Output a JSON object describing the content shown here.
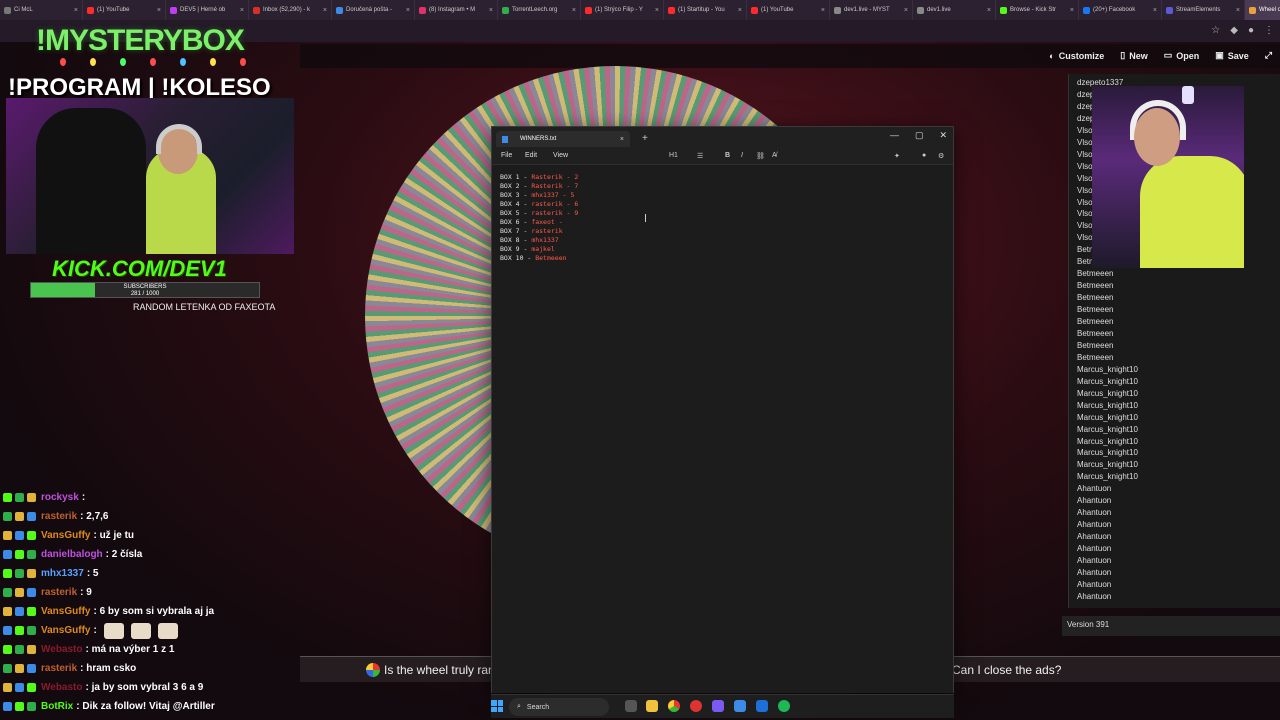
{
  "browser": {
    "tabs": [
      {
        "label": "Ci McL",
        "color": "#777777"
      },
      {
        "label": "(1) YouTube",
        "color": "#ff2a2a"
      },
      {
        "label": "DEV5 | Herné ob",
        "color": "#bf3df0"
      },
      {
        "label": "Inbox (52,290) - k",
        "color": "#d93025"
      },
      {
        "label": "Doručená pošta -",
        "color": "#3c8ce7"
      },
      {
        "label": "(8) Instagram • M",
        "color": "#e1306c"
      },
      {
        "label": "TorrentLeech.org",
        "color": "#2fae4a"
      },
      {
        "label": "(1) Strýco Filip - Y",
        "color": "#ff2a2a"
      },
      {
        "label": "(1) Startitup - You",
        "color": "#ff2a2a"
      },
      {
        "label": "(1) YouTube",
        "color": "#ff2a2a"
      },
      {
        "label": "dev1.live - MYST",
        "color": "#888888"
      },
      {
        "label": "dev1.live",
        "color": "#888888"
      },
      {
        "label": "Browse - Kick Str",
        "color": "#53fc18"
      },
      {
        "label": "(20+) Facebook",
        "color": "#1877f2"
      },
      {
        "label": "StreamElements",
        "color": "#5a5ad6"
      },
      {
        "label": "Wheel of Nam",
        "color": "#e9a23b"
      }
    ]
  },
  "site_actions": {
    "customize": "Customize",
    "new": "New",
    "open": "Open",
    "save": "Save"
  },
  "overlay": {
    "mysterybox": "!MYSTERYBOX",
    "program": "!PROGRAM | !KOLESO",
    "kick": "KICK.COM/DEV1",
    "subs_label": "SUBSCRIBERS",
    "subs_count": "281 / 1000",
    "subs_progress": 0.281,
    "letenka": "RANDOM LETENKA OD FAXEOTA"
  },
  "chat": [
    {
      "name": "rockysk",
      "msg": ":",
      "color": "#c050e0"
    },
    {
      "name": "rasterik",
      "msg": ": 2,7,6",
      "color": "#c06030"
    },
    {
      "name": "VansGuffy",
      "msg": ": už je tu",
      "color": "#e08a1e"
    },
    {
      "name": "danielbalogh",
      "msg": ": 2 čísla",
      "color": "#c050e0"
    },
    {
      "name": "mhx1337",
      "msg": ": 5",
      "color": "#5aa0ff"
    },
    {
      "name": "rasterik",
      "msg": ": 9",
      "color": "#c06030"
    },
    {
      "name": "VansGuffy",
      "msg": ": 6 by som si vybrala aj ja",
      "color": "#e08a1e"
    },
    {
      "name": "VansGuffy",
      "msg": ":",
      "color": "#e08a1e"
    },
    {
      "name": "Webasto",
      "msg": ": má na výber 1 z 1",
      "color": "#8a1a2a"
    },
    {
      "name": "rasterik",
      "msg": ": hram csko",
      "color": "#c06030"
    },
    {
      "name": "Webasto",
      "msg": ": ja by som vybral 3 6 a 9",
      "color": "#8a1a2a"
    },
    {
      "name": "BotRix",
      "msg": ": Dik za follow! Vitaj @Artiller",
      "color": "#53fc18"
    }
  ],
  "ticker": {
    "q1": "Is the wheel truly ran",
    "q2": "Can I close the ads?"
  },
  "names_list": [
    "dzepeto1337",
    "dzepeto1337",
    "dzepeto1337",
    "dzepeto1337",
    "Vlso",
    "Vlso",
    "Vlso",
    "Vlso",
    "Vlso",
    "Vlso",
    "Vlso",
    "Vlso",
    "Vlso",
    "Vlso",
    "Betmeeen",
    "Betmeeen",
    "Betmeeen",
    "Betmeeen",
    "Betmeeen",
    "Betmeeen",
    "Betmeeen",
    "Betmeeen",
    "Betmeeen",
    "Betmeeen",
    "Marcus_knight10",
    "Marcus_knight10",
    "Marcus_knight10",
    "Marcus_knight10",
    "Marcus_knight10",
    "Marcus_knight10",
    "Marcus_knight10",
    "Marcus_knight10",
    "Marcus_knight10",
    "Marcus_knight10",
    "Ahantuon",
    "Ahantuon",
    "Ahantuon",
    "Ahantuon",
    "Ahantuon",
    "Ahantuon",
    "Ahantuon",
    "Ahantuon",
    "Ahantuon",
    "Ahantuon"
  ],
  "version": "Version 391",
  "notepad": {
    "tab_title": "WINNERS.txt",
    "menu": {
      "file": "File",
      "edit": "Edit",
      "view": "View"
    },
    "heading_btn": "H1",
    "lines": [
      {
        "prefix": "BOX 1 - ",
        "name": "Rasterik - 2"
      },
      {
        "prefix": "BOX 2 - ",
        "name": "Rasterik - 7"
      },
      {
        "prefix": "BOX 3 - ",
        "name": "mhx1337 - 5"
      },
      {
        "prefix": "BOX 4 - ",
        "name": "rasterik - 6"
      },
      {
        "prefix": "BOX 5 - ",
        "name": "rasterik - 9"
      },
      {
        "prefix": "BOX 6 - ",
        "name": "faxeot -"
      },
      {
        "prefix": "BOX 7 - ",
        "name": "rasterik"
      },
      {
        "prefix": "BOX 8 - ",
        "name": "mhx1337"
      },
      {
        "prefix": "BOX 9 - ",
        "name": "majkel"
      },
      {
        "prefix": "BOX 10 - ",
        "name": "Betmeeen"
      }
    ]
  },
  "taskbar": {
    "search": "Search"
  }
}
